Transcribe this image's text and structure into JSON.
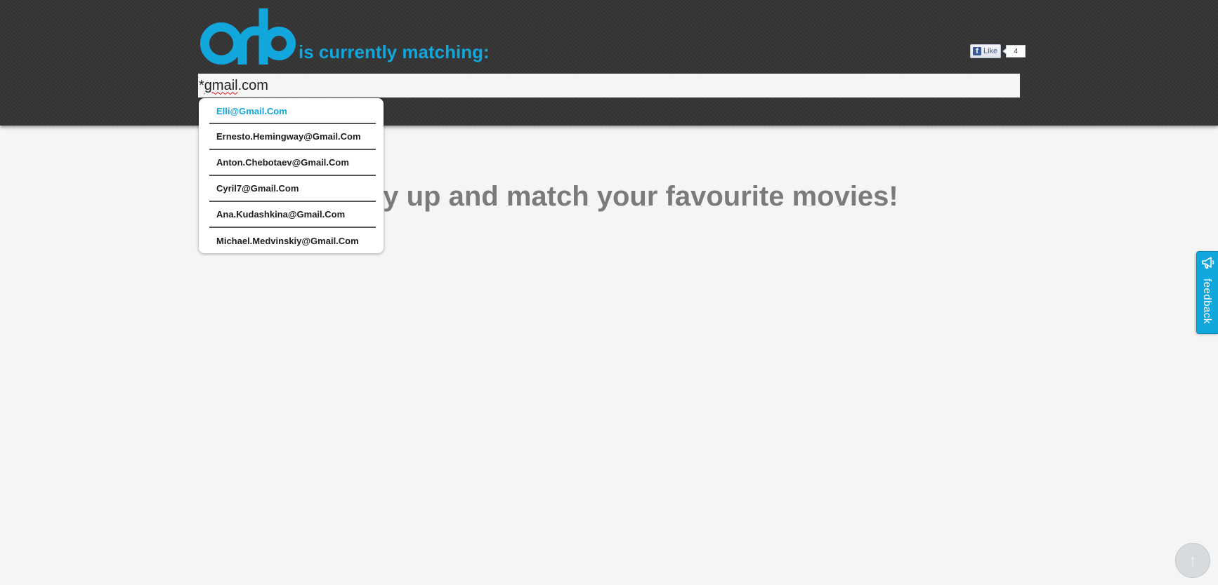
{
  "header": {
    "logo_text": "orb",
    "tagline": "is currently matching:",
    "facebook_like": {
      "label": "Like",
      "count": "4"
    }
  },
  "search": {
    "value_prefix": "*",
    "value_word": "gmail",
    "value_suffix": ".com"
  },
  "suggestions": [
    {
      "label": "Elli@Gmail.Com",
      "highlighted": true
    },
    {
      "label": "Ernesto.Hemingway@Gmail.Com",
      "highlighted": false
    },
    {
      "label": "Anton.Chebotaev@Gmail.Com",
      "highlighted": false
    },
    {
      "label": "Cyril7@Gmail.Com",
      "highlighted": false
    },
    {
      "label": "Ana.Kudashkina@Gmail.Com",
      "highlighted": false
    },
    {
      "label": "Michael.Medvinskiy@Gmail.Com",
      "highlighted": false
    }
  ],
  "main": {
    "headline_visible": "y up and match your favourite movies!"
  },
  "feedback": {
    "label": "feedback",
    "icon": "megaphone-icon"
  },
  "scroll_top": {
    "icon": "arrow-up-icon",
    "glyph": "↑"
  },
  "colors": {
    "accent": "#12a7dc",
    "header_bg": "#353535",
    "page_bg": "#f4f5f4",
    "headline": "#7b7b7b"
  }
}
